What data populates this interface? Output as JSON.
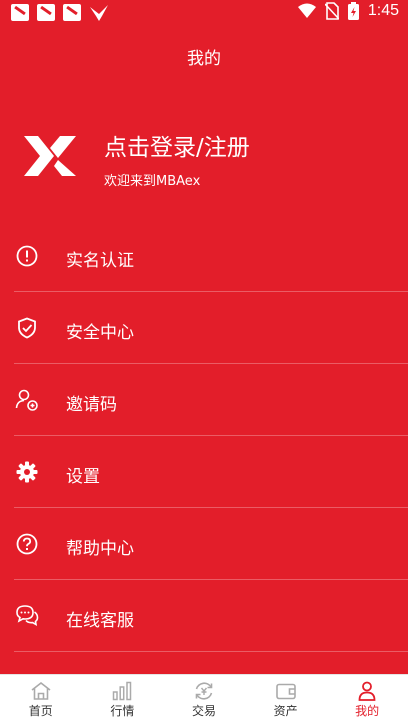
{
  "status_bar": {
    "time": "1:45",
    "notification_icons": [
      "app-notification-icon",
      "app-notification-icon",
      "app-notification-icon",
      "bird-logo-icon"
    ],
    "system_icons": [
      "wifi-icon",
      "no-sim-icon",
      "battery-charging-icon"
    ]
  },
  "header": {
    "title": "我的"
  },
  "profile": {
    "login_title": "点击登录/注册",
    "welcome_text": "欢迎来到MBAex"
  },
  "menu": {
    "items": [
      {
        "label": "实名认证",
        "icon": "alert-circle-icon"
      },
      {
        "label": "安全中心",
        "icon": "shield-check-icon"
      },
      {
        "label": "邀请码",
        "icon": "user-add-icon"
      },
      {
        "label": "设置",
        "icon": "gear-icon"
      },
      {
        "label": "帮助中心",
        "icon": "help-circle-icon"
      },
      {
        "label": "在线客服",
        "icon": "chat-bubbles-icon"
      }
    ]
  },
  "tabbar": {
    "tabs": [
      {
        "label": "首页",
        "icon": "home-icon",
        "active": false
      },
      {
        "label": "行情",
        "icon": "bar-chart-icon",
        "active": false
      },
      {
        "label": "交易",
        "icon": "exchange-icon",
        "active": false
      },
      {
        "label": "资产",
        "icon": "wallet-icon",
        "active": false
      },
      {
        "label": "我的",
        "icon": "user-icon",
        "active": true
      }
    ]
  },
  "colors": {
    "brand_red": "#e31e2a",
    "text_white": "#ffffff",
    "tab_inactive": "#aaaaaa",
    "tab_label": "#333333"
  }
}
